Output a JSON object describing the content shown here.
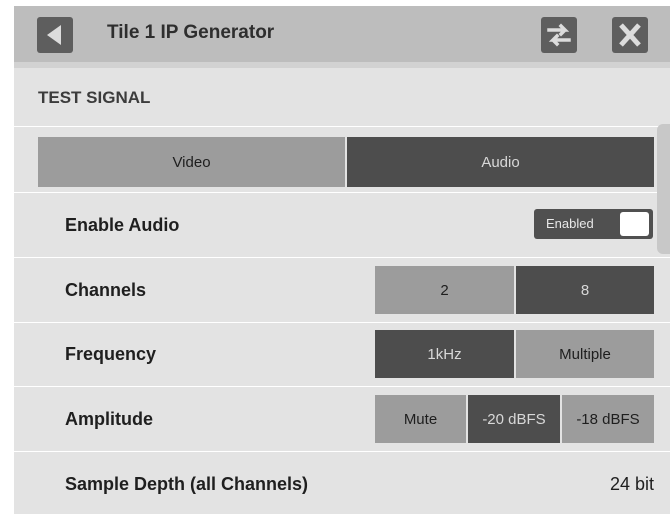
{
  "header": {
    "title": "Tile 1 IP Generator",
    "back_icon": "back-arrow-icon",
    "swap_icon": "swap-arrows-icon",
    "close_icon": "close-x-icon"
  },
  "section": {
    "title": "TEST SIGNAL"
  },
  "tabs": [
    {
      "label": "Video",
      "selected": false
    },
    {
      "label": "Audio",
      "selected": true
    }
  ],
  "rows": {
    "enable_audio": {
      "label": "Enable Audio",
      "toggle_text": "Enabled",
      "on": true
    },
    "channels": {
      "label": "Channels",
      "options": [
        "2",
        "8"
      ],
      "selected": "8"
    },
    "frequency": {
      "label": "Frequency",
      "options": [
        "1kHz",
        "Multiple"
      ],
      "selected": "1kHz"
    },
    "amplitude": {
      "label": "Amplitude",
      "options": [
        "Mute",
        "-20 dBFS",
        "-18 dBFS"
      ],
      "selected": "-20 dBFS"
    },
    "sample_depth": {
      "label": "Sample Depth (all Channels)",
      "value": "24 bit"
    }
  },
  "colors": {
    "selected": "#4d4d4d",
    "unselected": "#9c9c9c",
    "panel": "#e3e3e3",
    "header": "#bdbdbd"
  }
}
